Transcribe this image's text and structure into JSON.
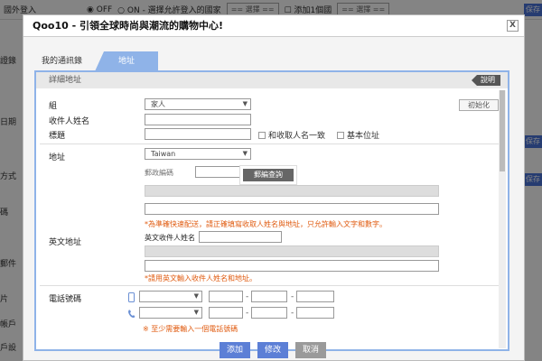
{
  "background": {
    "top_label": "國外登入",
    "radio_off": "OFF",
    "radio_on": "ON - 選擇允許登入的國家",
    "select1": "== 選擇 ==",
    "add_label": "添加1個國",
    "select2": "== 選擇 ==",
    "save_label": "保存",
    "left_labels": [
      "證錄",
      "日期",
      "方式",
      "碼",
      "郵件",
      "片",
      "帳戶",
      "戶設"
    ]
  },
  "dialog": {
    "title": "Qoo10 - 引領全球時尚與潮流的購物中心!",
    "close": "X",
    "tabs": [
      {
        "label": "我的通訊錄",
        "active": false
      },
      {
        "label": "地址",
        "active": true
      }
    ],
    "section_title": "詳細地址",
    "help_tag": "說明",
    "init_button": "初始化",
    "fields": {
      "group_label": "組",
      "group_value": "家人",
      "recipient_label": "收件人姓名",
      "title_label": "標題",
      "same_as_recipient": "和收取人名一致",
      "default_address": "基本位址",
      "address_label": "地址",
      "country_value": "Taiwan",
      "zip_label": "郵政編碼",
      "zip_search_button": "郵編查詢",
      "address_note": "*為準確快速配送，請正確填寫收取人姓名與地址，只允許輸入文字和數字。",
      "english_address_label": "英文地址",
      "english_recipient_label": "英文收件人姓名",
      "english_note": "*請用英文輸入收件人姓名和地址。",
      "phone_label": "電話號碼",
      "phone_note": "※ 至少需要輸入一個電話號碼"
    },
    "footer": {
      "add_button": "添加",
      "edit_button": "修改",
      "cancel_button": "取消"
    }
  },
  "colors": {
    "tab_active": "#8fb3e8",
    "note": "#e05b10",
    "footer_add": "#5c7fd6",
    "footer_edit": "#5c7fd6",
    "footer_cancel": "#9a9a9a"
  }
}
